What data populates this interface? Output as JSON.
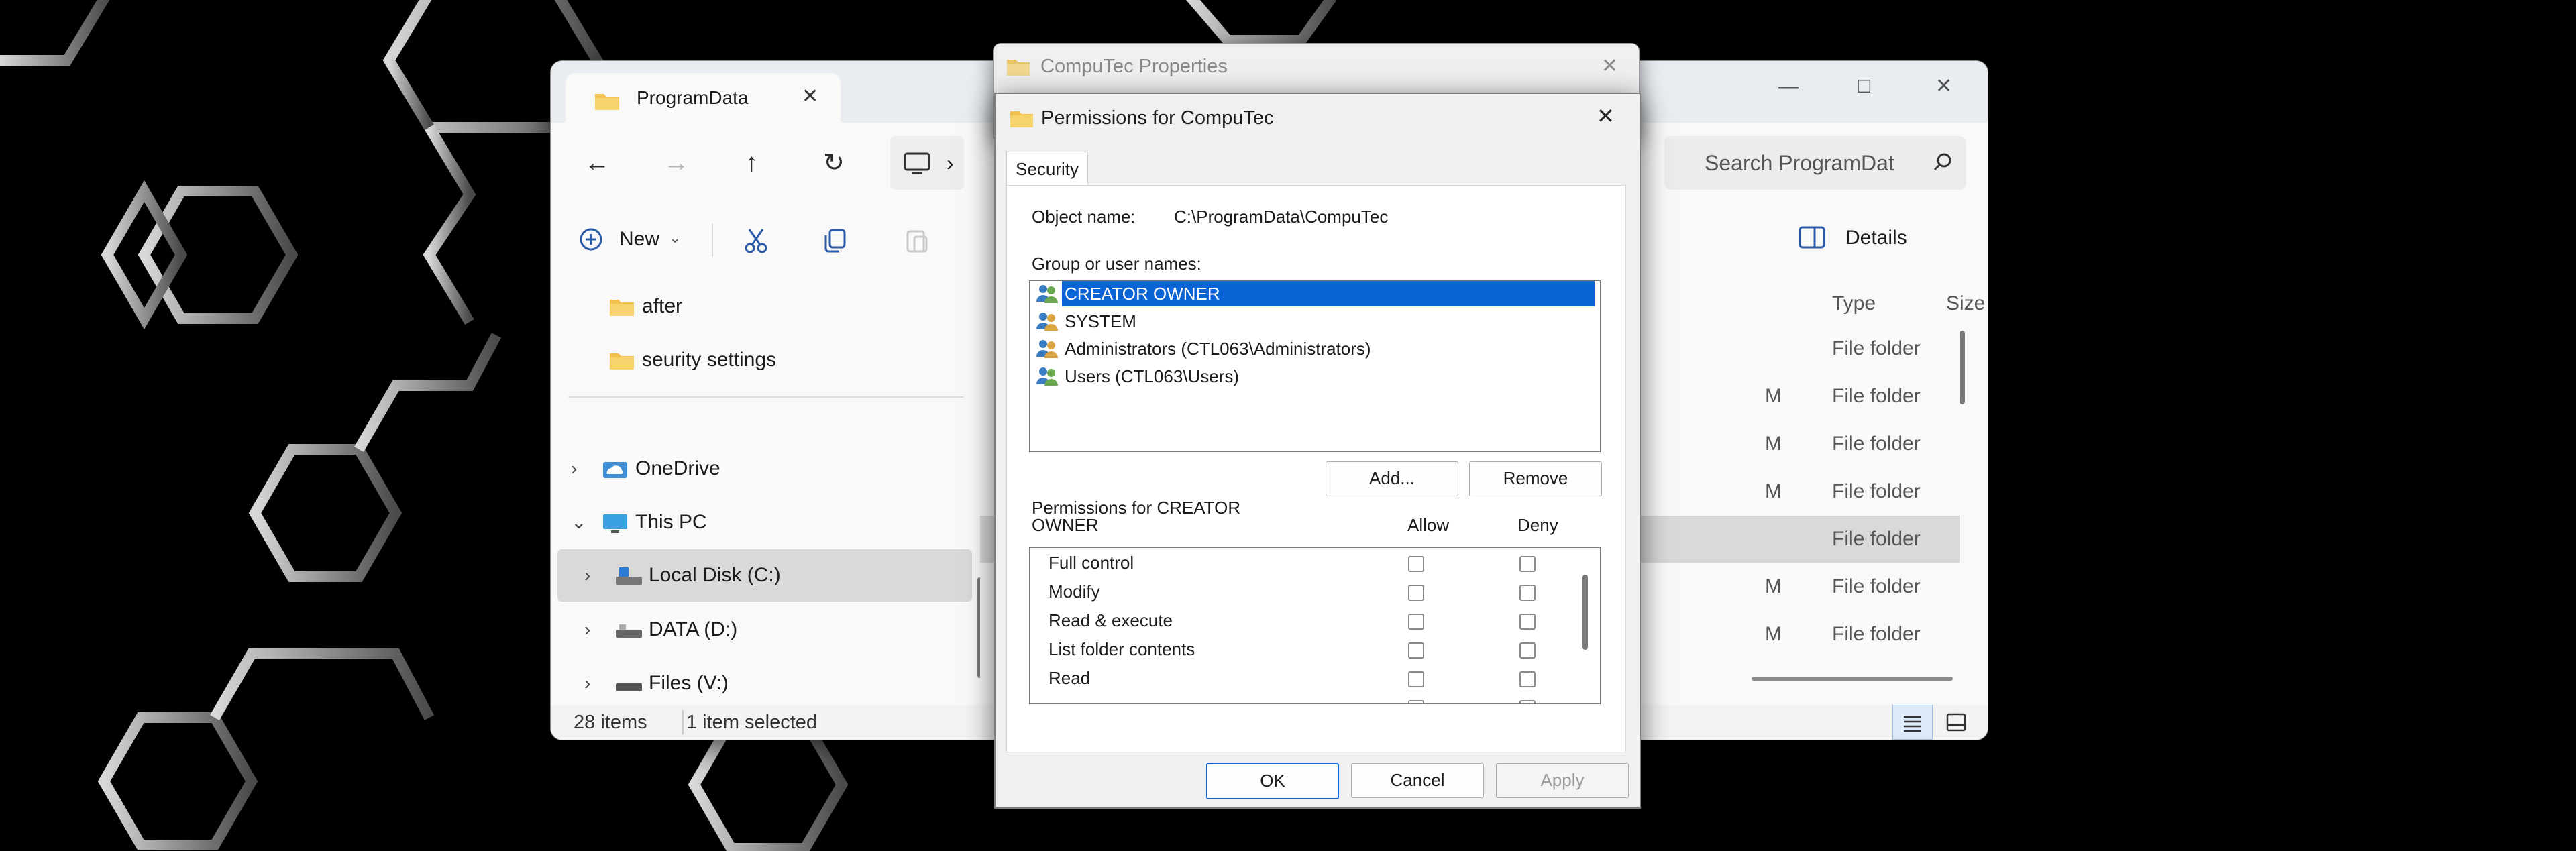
{
  "explorer": {
    "tab_title": "ProgramData",
    "search_placeholder": "Search ProgramDat",
    "new_label": "New",
    "details_label": "Details",
    "nav": {
      "items": [
        {
          "label": "after"
        },
        {
          "label": "seurity settings"
        },
        {
          "label": "OneDrive"
        },
        {
          "label": "This PC"
        },
        {
          "label": "Local Disk (C:)"
        },
        {
          "label": "DATA (D:)"
        },
        {
          "label": "Files (V:)"
        }
      ]
    },
    "columns": {
      "type": "Type",
      "size": "Size"
    },
    "rows": [
      {
        "date_tail": "",
        "type": "File folder"
      },
      {
        "date_tail": "M",
        "type": "File folder"
      },
      {
        "date_tail": "M",
        "type": "File folder"
      },
      {
        "date_tail": "M",
        "type": "File folder"
      },
      {
        "date_tail": "",
        "type": "File folder"
      },
      {
        "date_tail": "M",
        "type": "File folder"
      },
      {
        "date_tail": "M",
        "type": "File folder"
      }
    ],
    "status": {
      "items": "28 items",
      "selected": "1 item selected"
    }
  },
  "properties": {
    "title": "CompuTec Properties"
  },
  "permissions": {
    "title": "Permissions for CompuTec",
    "tab": "Security",
    "object_name_label": "Object name:",
    "object_name_value": "C:\\ProgramData\\CompuTec",
    "group_label": "Group or user names:",
    "users": [
      {
        "name": "CREATOR OWNER"
      },
      {
        "name": "SYSTEM"
      },
      {
        "name": "Administrators (CTL063\\Administrators)"
      },
      {
        "name": "Users (CTL063\\Users)"
      }
    ],
    "add_button": "Add...",
    "remove_button": "Remove",
    "perm_for_line1": "Permissions for CREATOR",
    "perm_for_line2": "OWNER",
    "allow_header": "Allow",
    "deny_header": "Deny",
    "perms": [
      {
        "label": "Full control",
        "allow": false,
        "deny": false
      },
      {
        "label": "Modify",
        "allow": false,
        "deny": false
      },
      {
        "label": "Read & execute",
        "allow": false,
        "deny": false
      },
      {
        "label": "List folder contents",
        "allow": false,
        "deny": false
      },
      {
        "label": "Read",
        "allow": false,
        "deny": false
      }
    ],
    "ok_button": "OK",
    "cancel_button": "Cancel",
    "apply_button": "Apply"
  },
  "colors": {
    "accent": "#0a64d6",
    "folder": "#f2c14e",
    "background": "#000000"
  }
}
